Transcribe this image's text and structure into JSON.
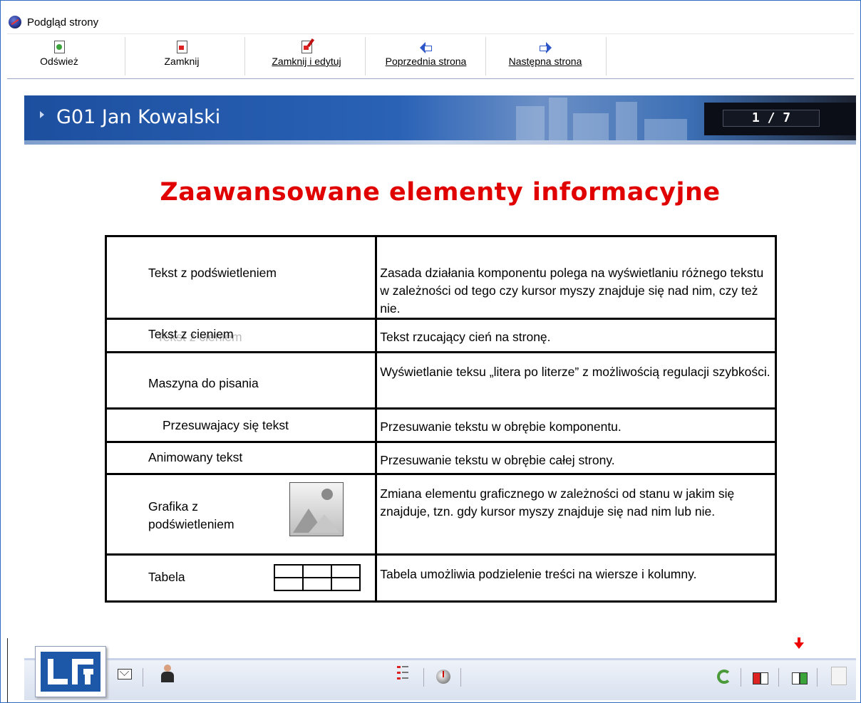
{
  "window": {
    "title": "Podgląd strony"
  },
  "toolbar": {
    "refresh": "Odśwież",
    "close": "Zamknij",
    "close_edit": "Zamknij i edytuj",
    "prev": "Poprzednia strona",
    "next": "Następna strona"
  },
  "page_header": {
    "title": "G01 Jan Kowalski",
    "counter": "1 / 7"
  },
  "main_title": "Zaawansowane elementy informacyjne",
  "table": {
    "rows": [
      {
        "name": "Tekst z podświetleniem",
        "desc": "Zasada działania komponentu polega na wyświetlaniu różnego tekstu w zależności od tego czy kursor myszy znajduje się nad nim, czy też nie."
      },
      {
        "name": "Tekst z cieniem",
        "desc": "Tekst rzucający cień na stronę."
      },
      {
        "name": "Maszyna do pisania",
        "desc": "Wyświetlanie teksu „litera po literze” z możliwością regulacji szybkości."
      },
      {
        "name": "Przesuwajacy się tekst",
        "desc": "Przesuwanie tekstu w obrębie komponentu."
      },
      {
        "name": "Animowany tekst",
        "desc": "Przesuwanie tekstu w obrębie całej strony."
      },
      {
        "name_line1": "Grafika z",
        "name_line2": "podświetleniem",
        "desc": "Zmiana elementu graficznego w zależności od stanu w jakim się znajduje, tzn. gdy kursor myszy znajduje się nad nim lub nie."
      },
      {
        "name": "Tabela",
        "desc": "Tabela umożliwia podzielenie treści na wiersze i kolumny."
      }
    ]
  },
  "footer_icons": [
    "logo",
    "envelope-icon",
    "user-icon",
    "list-icon",
    "globe-icon",
    "reload-icon",
    "previous-page-icon",
    "next-page-icon",
    "print-icon"
  ]
}
